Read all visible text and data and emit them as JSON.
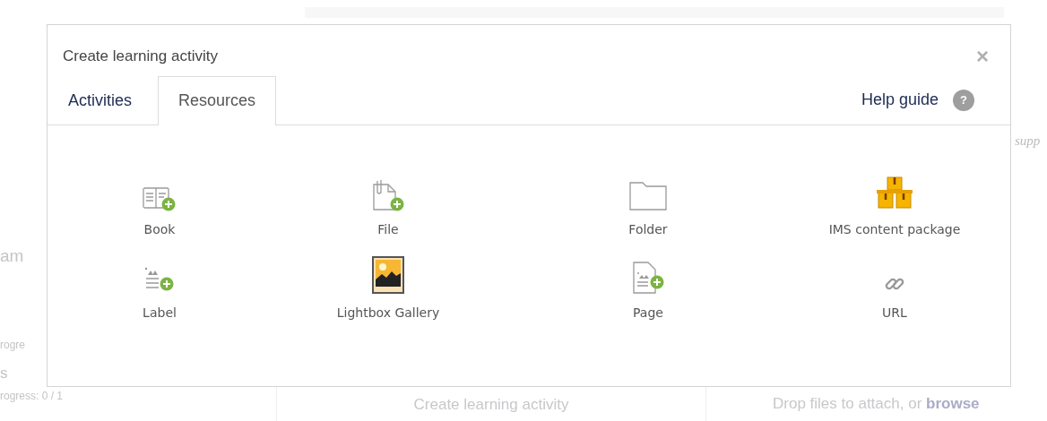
{
  "background": {
    "left_texts": [
      "am",
      "rogre",
      "s",
      "rogress: 0 / 1"
    ],
    "right_text": "supp",
    "bottom_card": "Create learning activity",
    "dropzone": {
      "text": "Drop files to attach, or ",
      "link": "browse"
    }
  },
  "dialog": {
    "title": "Create learning activity",
    "close": "×",
    "tabs": [
      {
        "label": "Activities",
        "selected": false
      },
      {
        "label": "Resources",
        "selected": true
      }
    ],
    "help": {
      "label": "Help guide",
      "icon": "?"
    },
    "items": [
      {
        "label": "Book",
        "kind": "book"
      },
      {
        "label": "File",
        "kind": "file"
      },
      {
        "label": "Folder",
        "kind": "folder"
      },
      {
        "label": "IMS content package",
        "kind": "boxes"
      },
      {
        "label": "Label",
        "kind": "label"
      },
      {
        "label": "Lightbox Gallery",
        "kind": "gallery"
      },
      {
        "label": "Page",
        "kind": "page"
      },
      {
        "label": "URL",
        "kind": "link"
      }
    ]
  }
}
